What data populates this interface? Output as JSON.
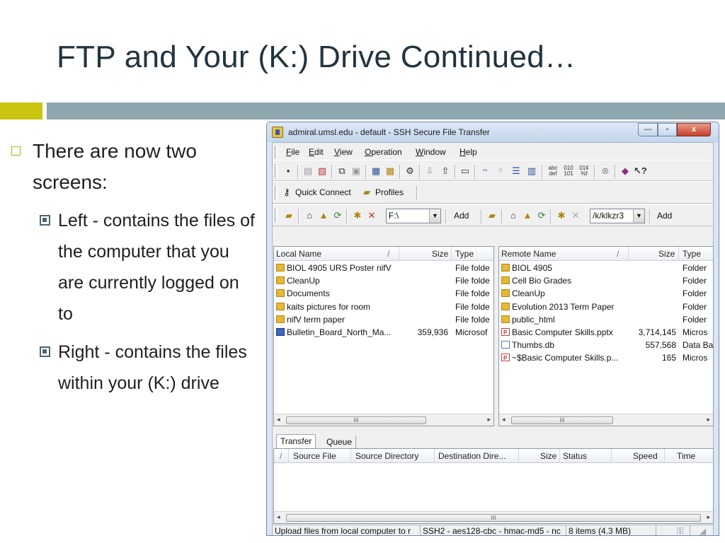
{
  "slide": {
    "title": "FTP and Your (K:) Drive Continued…",
    "bullet": "There are now two screens:",
    "sub_bullets": [
      "Left - contains the files of the computer that you are currently logged on to",
      "Right - contains the files within your (K:) drive"
    ]
  },
  "window": {
    "title": "admiral.umsl.edu - default - SSH Secure File Transfer",
    "controls": {
      "minimize": "—",
      "maximize": "▫",
      "close": "x"
    },
    "menu": [
      "File",
      "Edit",
      "View",
      "Operation",
      "Window",
      "Help"
    ],
    "profile_bar": {
      "quick_connect": "Quick Connect",
      "profiles": "Profiles"
    },
    "left_path": "F:\\",
    "right_path": "/k/klkzr3",
    "add_label": "Add",
    "local": {
      "columns": [
        "Local Name",
        "/",
        "Size",
        "Type"
      ],
      "rows": [
        {
          "name": "BIOL 4905 URS Poster nifV",
          "size": "",
          "type": "File folde",
          "icon": "folder"
        },
        {
          "name": "CleanUp",
          "size": "",
          "type": "File folde",
          "icon": "folder"
        },
        {
          "name": "Documents",
          "size": "",
          "type": "File folde",
          "icon": "folder"
        },
        {
          "name": "kaits pictures for room",
          "size": "",
          "type": "File folde",
          "icon": "folder"
        },
        {
          "name": "nifV term paper",
          "size": "",
          "type": "File folde",
          "icon": "folder"
        },
        {
          "name": "Bulletin_Board_North_Ma...",
          "size": "359,936",
          "type": "Microsof",
          "icon": "pub"
        }
      ]
    },
    "remote": {
      "columns": [
        "Remote Name",
        "/",
        "Size",
        "Type"
      ],
      "rows": [
        {
          "name": "BIOL 4905",
          "size": "",
          "type": "Folder",
          "icon": "folder"
        },
        {
          "name": "Cell Bio Grades",
          "size": "",
          "type": "Folder",
          "icon": "folder"
        },
        {
          "name": "CleanUp",
          "size": "",
          "type": "Folder",
          "icon": "folder"
        },
        {
          "name": "Evolution 2013 Term Paper",
          "size": "",
          "type": "Folder",
          "icon": "folder"
        },
        {
          "name": "public_html",
          "size": "",
          "type": "Folder",
          "icon": "folder"
        },
        {
          "name": "Basic Computer Skills.pptx",
          "size": "3,714,145",
          "type": "Micros",
          "icon": "doc"
        },
        {
          "name": "Thumbs.db",
          "size": "557,568",
          "type": "Data Ba",
          "icon": "db"
        },
        {
          "name": "~$Basic Computer Skills.p...",
          "size": "165",
          "type": "Micros",
          "icon": "doc"
        }
      ]
    },
    "tabs": [
      "Transfer",
      "Queue"
    ],
    "queue_columns": [
      "/",
      "Source File",
      "Source Directory",
      "Destination Dire...",
      "Size",
      "Status",
      "Speed",
      "Time"
    ],
    "scroll_thumb": "III",
    "status": {
      "hint": "Upload files from local computer to r",
      "cipher": "SSH2 - aes128-cbc - hmac-md5 - nc",
      "items": "8 items (4.3 MB)"
    }
  }
}
